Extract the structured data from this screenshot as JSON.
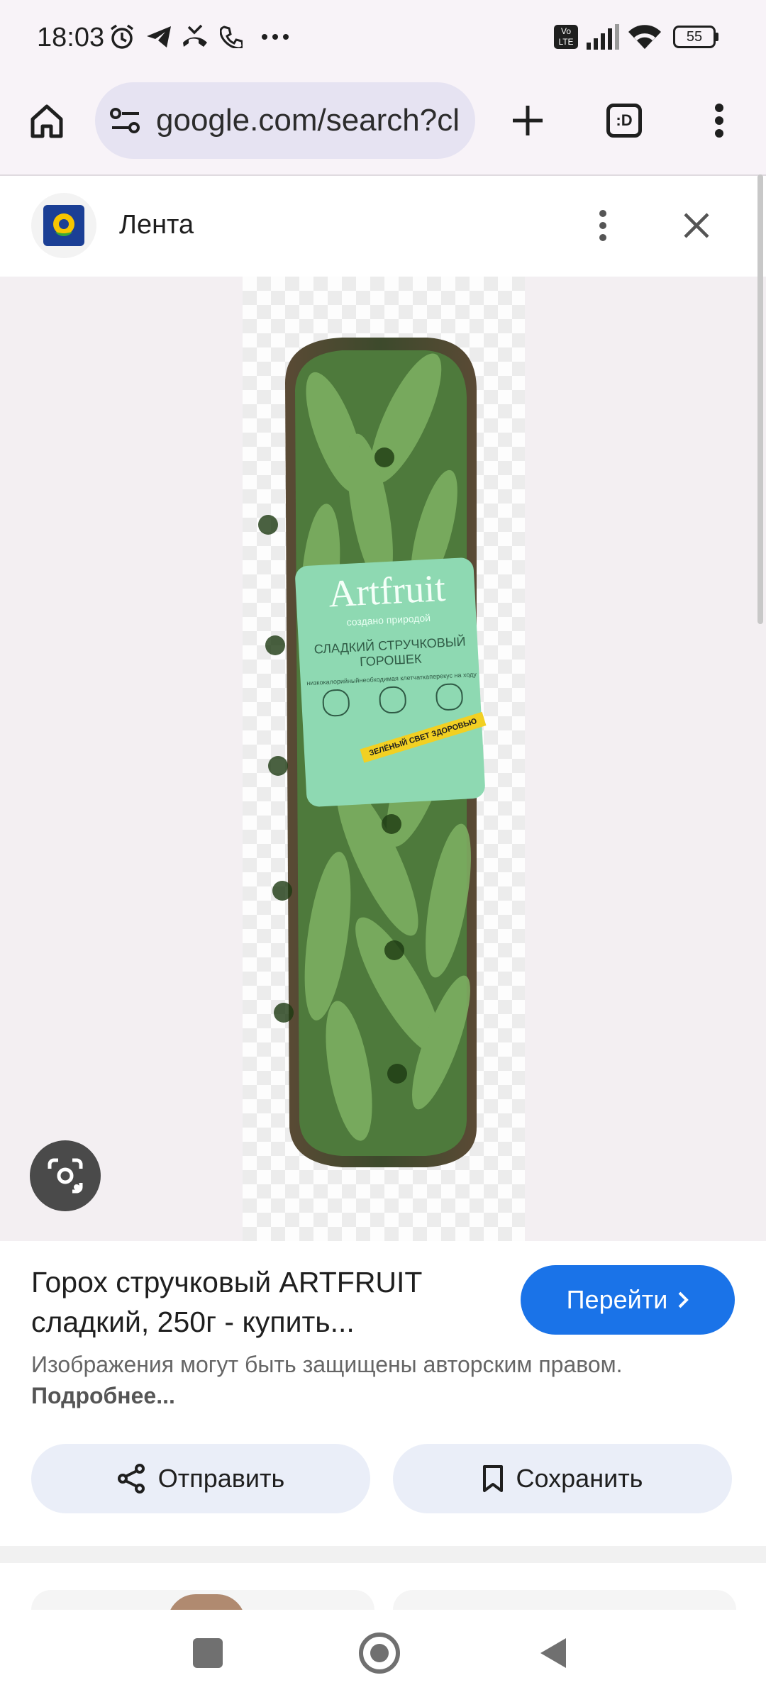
{
  "status_bar": {
    "time": "18:03",
    "battery": "55",
    "network_badge": "VoLTE"
  },
  "browser": {
    "url": "google.com/search?cl"
  },
  "source": {
    "name": "Лента"
  },
  "product_image": {
    "brand": "Artfruit",
    "tagline": "создано природой",
    "product_line1": "СЛАДКИЙ СТРУЧКОВЫЙ",
    "product_line2": "ГОРОШЕК",
    "feature1": "низкокалорийный",
    "feature2": "необходимая клетчатка",
    "feature3": "перекус на ходу",
    "banner": "ЗЕЛЁНЫЙ СВЕТ ЗДОРОВЬЮ"
  },
  "result": {
    "title": "Горох стручковый ARTFRUIT сладкий, 250г - купить...",
    "go_button": "Перейти",
    "copyright": "Изображения могут быть защищены авторским правом.",
    "more_link": "Подробнее..."
  },
  "actions": {
    "share": "Отправить",
    "save": "Сохранить"
  },
  "colors": {
    "accent": "#1a73e8",
    "pill_bg": "#eaeef8",
    "url_bg": "#e6e3f2"
  }
}
